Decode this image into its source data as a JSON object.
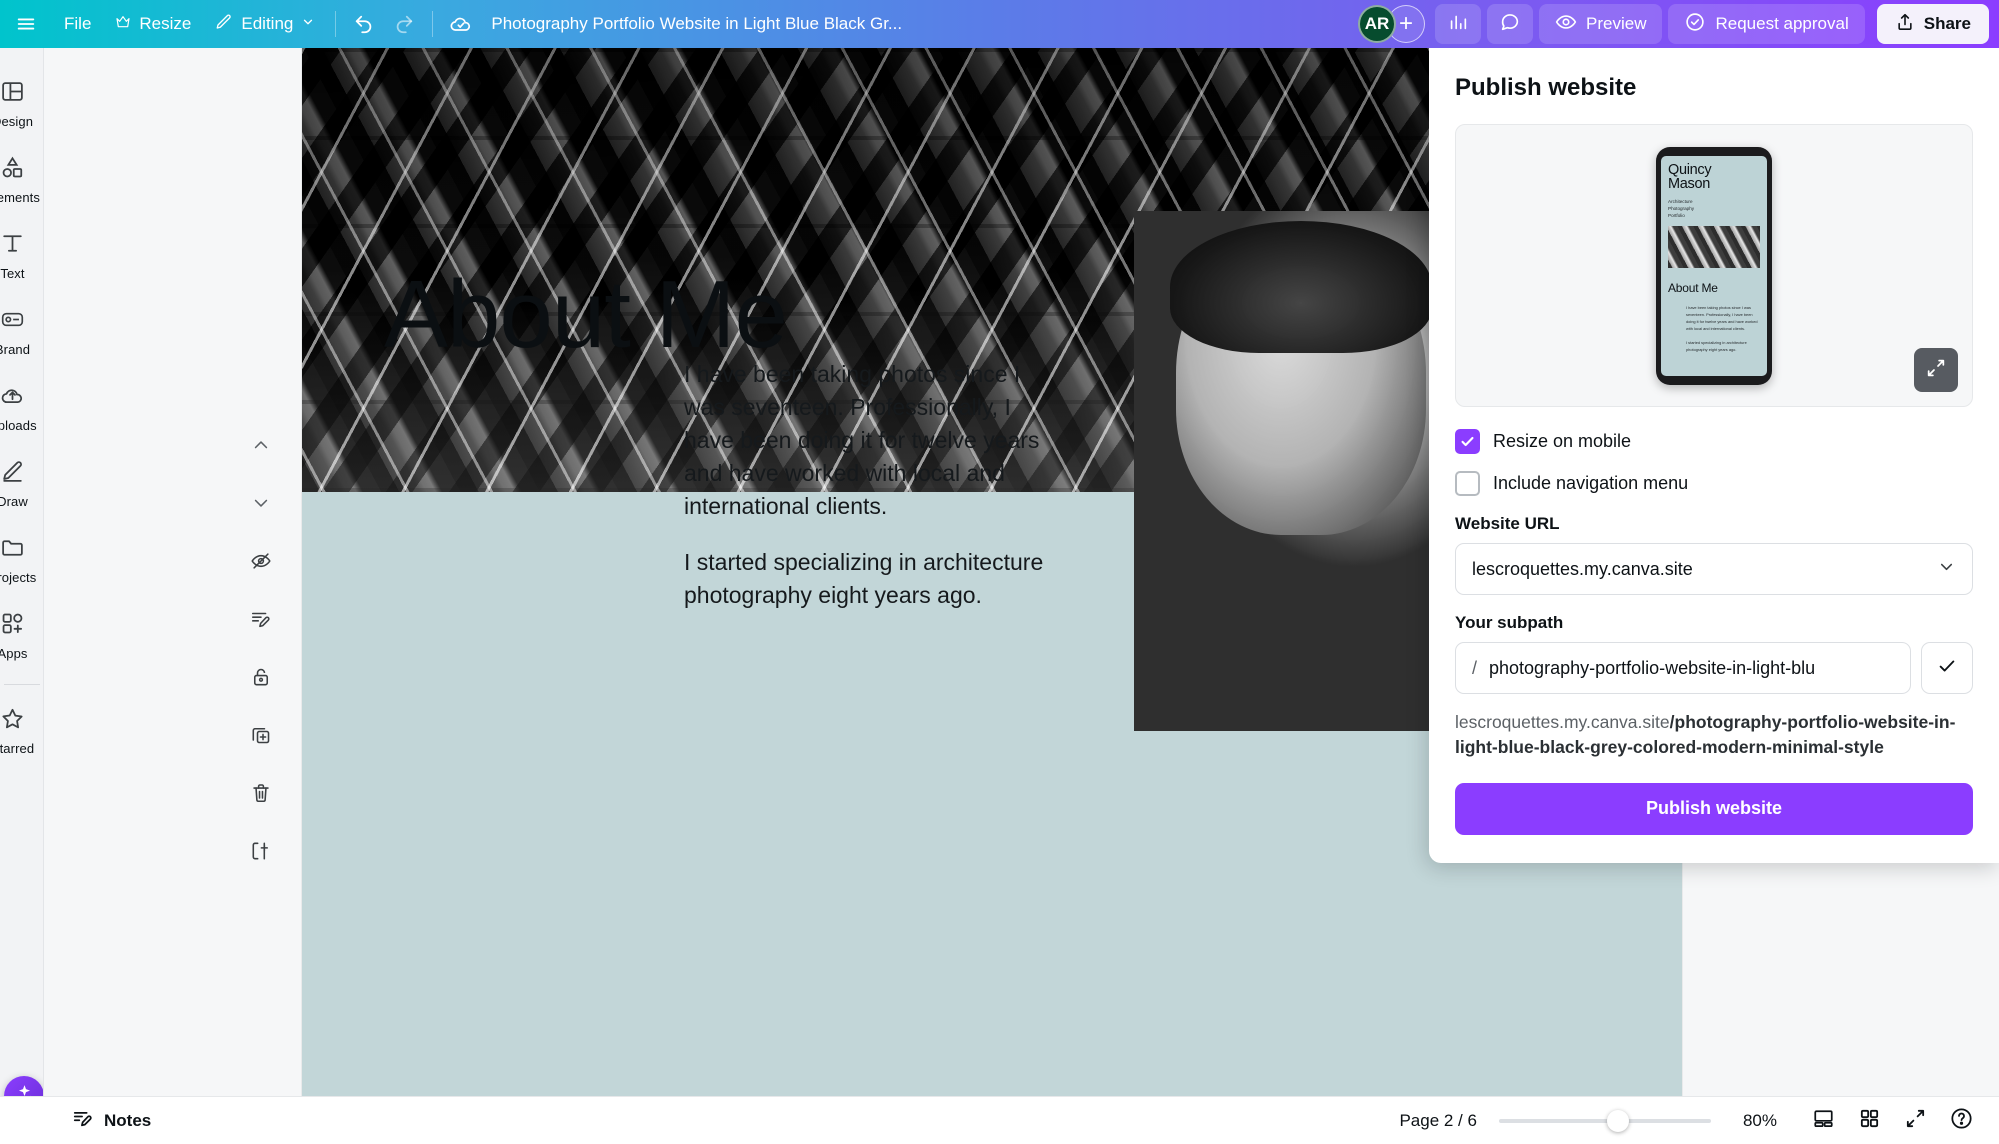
{
  "topbar": {
    "menu_icon": "hamburger-icon",
    "file_label": "File",
    "resize_label": "Resize",
    "resize_icon": "crown-icon",
    "editing_label": "Editing",
    "editing_icon": "pencil-icon",
    "editing_chevron": "chevron-down-icon",
    "undo_icon": "undo-icon",
    "redo_icon": "redo-icon",
    "cloud_icon": "cloud-check-icon",
    "title": "Photography Portfolio Website in Light Blue  Black  Gr...",
    "avatar_initials": "AR",
    "add_collaborator": "+",
    "insights_icon": "bar-chart-icon",
    "comment_icon": "comment-icon",
    "preview_label": "Preview",
    "preview_icon": "eye-icon",
    "approval_label": "Request approval",
    "approval_icon": "check-circle-icon",
    "share_label": "Share",
    "share_icon": "share-upload-icon"
  },
  "sidebar": {
    "items": [
      {
        "label": "Design",
        "icon": "design-layout-icon"
      },
      {
        "label": "Elements",
        "icon": "shapes-icon"
      },
      {
        "label": "Text",
        "icon": "text-t-icon"
      },
      {
        "label": "Brand",
        "icon": "brand-palette-icon"
      },
      {
        "label": "Uploads",
        "icon": "cloud-upload-icon"
      },
      {
        "label": "Draw",
        "icon": "pen-draw-icon"
      },
      {
        "label": "Projects",
        "icon": "folder-icon"
      },
      {
        "label": "Apps",
        "icon": "apps-grid-plus-icon"
      },
      {
        "label": "Starred",
        "icon": "star-icon"
      }
    ],
    "ai_button_icon": "magic-ai-icon"
  },
  "page_tools": [
    {
      "icon": "chevron-up-icon",
      "name": "move-page-up"
    },
    {
      "icon": "chevron-down-icon",
      "name": "move-page-down"
    },
    {
      "icon": "eye-off-icon",
      "name": "hide-page"
    },
    {
      "icon": "notes-pencil-icon",
      "name": "page-notes"
    },
    {
      "icon": "lock-icon",
      "name": "lock-page"
    },
    {
      "icon": "duplicate-icon",
      "name": "duplicate-page"
    },
    {
      "icon": "trash-icon",
      "name": "delete-page"
    },
    {
      "icon": "add-page-icon",
      "name": "add-page"
    }
  ],
  "canvas": {
    "heading": "About Me",
    "paragraph_1": "I have been taking photos since I was seventeen. Professionally, I have been doing it for twelve years and have worked with local and international clients.",
    "paragraph_2": "I started specializing in architecture photography eight years ago.",
    "background_color": "#c2d6d8",
    "hero_image_alt": "architecture-hexagon-facade-photo",
    "portrait_image_alt": "man-portrait-striped-shirt-photo"
  },
  "publish_panel": {
    "title": "Publish website",
    "preview": {
      "site_title_line1": "Quincy",
      "site_title_line2": "Mason",
      "subtitle": "Architecture\nPhotography\nPortfolio",
      "section_heading": "About Me",
      "body_1": "I have been taking photos since I was seventeen. Professionally, I have been doing it for twelve years and have worked with local and international clients.",
      "body_2": "I started specializing in architecture photography eight years ago.",
      "expand_icon": "expand-arrows-icon"
    },
    "resize_on_mobile": {
      "label": "Resize on mobile",
      "checked": true
    },
    "include_nav_menu": {
      "label": "Include navigation menu",
      "checked": false
    },
    "website_url_label": "Website URL",
    "website_url_value": "lescroquettes.my.canva.site",
    "website_url_chevron": "chevron-down-icon",
    "subpath_label": "Your subpath",
    "subpath_slash": "/",
    "subpath_value": "photography-portfolio-website-in-light-blu",
    "confirm_icon": "check-icon",
    "url_preview_domain": "lescroquettes.my.canva.site",
    "url_preview_path": "/photography-portfolio-website-in-light-blue-black-grey-colored-modern-minimal-style",
    "publish_button": "Publish website",
    "accent_color": "#8b3dff"
  },
  "bottombar": {
    "notes_label": "Notes",
    "notes_icon": "notes-pencil-icon",
    "page_indicator": "Page 2 / 6",
    "zoom_value": "80%",
    "view_icon": "page-view-icon",
    "grid_icon": "grid-view-icon",
    "fullscreen_icon": "expand-arrows-icon",
    "help_icon": "help-circle-icon"
  }
}
